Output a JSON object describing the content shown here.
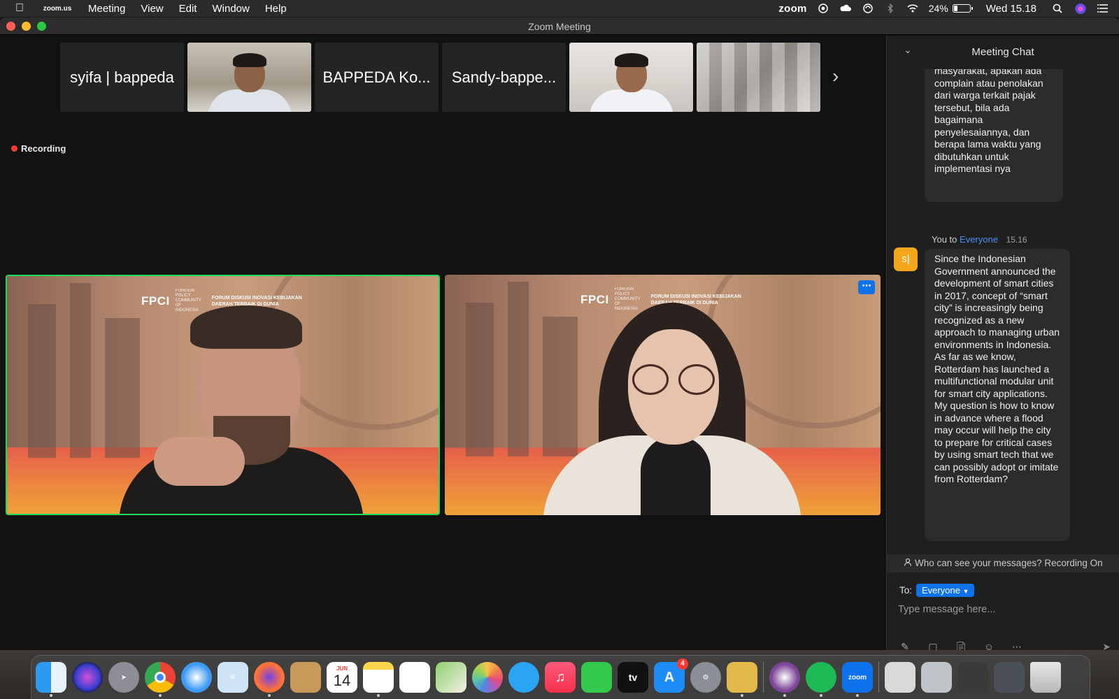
{
  "menubar": {
    "app_name": "zoom.us",
    "menus": [
      "Meeting",
      "View",
      "Edit",
      "Window",
      "Help"
    ],
    "zoom_word": "zoom",
    "battery_pct": "24%",
    "battery_level": 0.24,
    "clock": "Wed 15.18",
    "icons": [
      "apple-icon",
      "zoom-share-icon",
      "cloud-icon",
      "creative-cloud-icon",
      "bluetooth-icon",
      "wifi-icon",
      "battery-icon",
      "search-icon",
      "siri-icon",
      "control-center-icon"
    ]
  },
  "window": {
    "title": "Zoom Meeting"
  },
  "strip": {
    "participants": [
      {
        "name": "syifa | bappeda",
        "video": false
      },
      {
        "name": "",
        "video": true
      },
      {
        "name": "BAPPEDA Ko...",
        "video": false
      },
      {
        "name": "Sandy-bappe...",
        "video": false
      },
      {
        "name": "",
        "video": true
      },
      {
        "name": "",
        "video": true
      }
    ]
  },
  "recording": {
    "label": "Recording"
  },
  "tiles": {
    "banner_logo": "FPCI",
    "banner_sub": "FOREIGN POLICY COMMUNITY OF INDONESIA",
    "banner_forum": "FORUM DISKUSI INOVASI KEBIJAKAN DAERAH TERBAIK DI DUNIA"
  },
  "chat": {
    "title": "Meeting Chat",
    "prev_message": "masyarakat, apakah ada complain atau penolakan dari warga terkait pajak tersebut, bila ada bagaimana penyelesaiannya, dan berapa lama waktu yang dibutuhkan untuk implementasi nya",
    "sender": "You to",
    "recipient": "Everyone",
    "time": "15.16",
    "avatar_text": "s|",
    "message": "Since the Indonesian Government announced the development of smart cities in 2017, concept of “smart city” is increasingly being recognized as a new approach to managing urban environments in Indonesia. As far as we know, Rotterdam has launched a multifunctional modular unit for smart city applications. My question is how to know in advance where a flood may occur will help the city to prepare for critical cases by using smart tech that we can possibly adopt or imitate from Rotterdam?",
    "notice": "Who can see your messages? Recording On",
    "to_label": "To:",
    "to_value": "Everyone",
    "input_placeholder": "Type message here..."
  },
  "dock": {
    "apps": [
      "finder-icon",
      "siri-icon",
      "launchpad-icon",
      "chrome-icon",
      "safari-icon",
      "mail-icon",
      "firefox-icon",
      "contacts-icon",
      "calendar-icon",
      "notes-icon",
      "reminders-icon",
      "maps-icon",
      "photos-icon",
      "messages-icon",
      "music-icon",
      "facetime-icon",
      "appletv-icon",
      "appstore-icon",
      "system-preferences-icon",
      "archive-utility-icon",
      "tor-browser-icon",
      "spotify-icon",
      "zoom-icon",
      "printer-icon",
      "disk-icon",
      "document-icon",
      "screenshot-icon",
      "trash-icon"
    ],
    "calendar_month": "JUN",
    "calendar_day": "14",
    "appletv_label": "tv",
    "appstore_badge": "4",
    "zoom_label": "zoom"
  },
  "colors": {
    "accent": "#0e72ed",
    "active_speaker": "#23d959",
    "recording": "#ff3b30",
    "avatar": "#f4a61d"
  }
}
